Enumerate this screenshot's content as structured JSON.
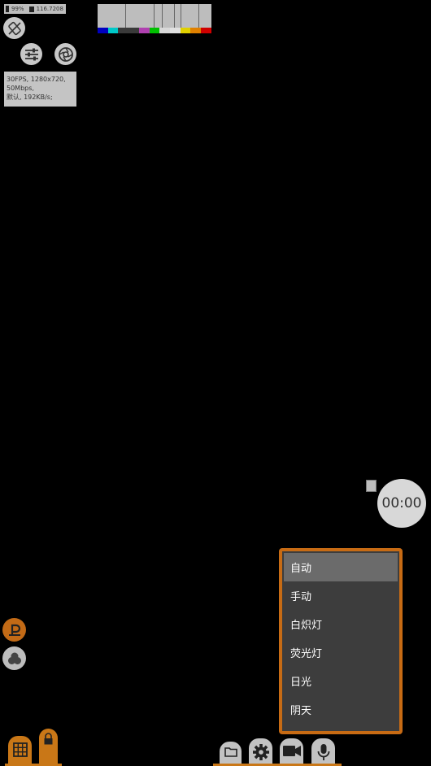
{
  "status": {
    "battery": "99%",
    "storage": "116.7208"
  },
  "info": {
    "line1": "30FPS, 1280x720,",
    "line2": "50Mbps,",
    "line3": "默认, 192KB/s;"
  },
  "timer": {
    "value": "00:00"
  },
  "wb_menu": {
    "items": [
      {
        "label": "自动",
        "selected": true
      },
      {
        "label": "手动"
      },
      {
        "label": "白炽灯"
      },
      {
        "label": "荧光灯"
      },
      {
        "label": "日光"
      },
      {
        "label": "阴天"
      }
    ]
  },
  "colors": {
    "accent": "#c97717",
    "menu_bg": "#3d3d3d",
    "menu_selected": "#6b6b6b",
    "control_gray": "#c8c8c8",
    "color_bars": [
      "#0000c0",
      "#00c8c8",
      "#3a3a3a",
      "#3a3a3a",
      "#b040b0",
      "#00c000",
      "#d8d8d8",
      "#e0e0e0",
      "#e0d000",
      "#e08000",
      "#d00000"
    ]
  },
  "icons": {
    "rotate": "rotate-lock-icon",
    "settings_sliders": "sliders-icon",
    "lens": "aperture-icon",
    "focus_mode": "p-mode-icon",
    "filters": "color-filter-icon",
    "grid": "grid-icon",
    "lock": "lock-icon",
    "gallery": "folder-icon",
    "gear": "gear-icon",
    "video": "video-camera-icon",
    "mic": "microphone-icon"
  }
}
